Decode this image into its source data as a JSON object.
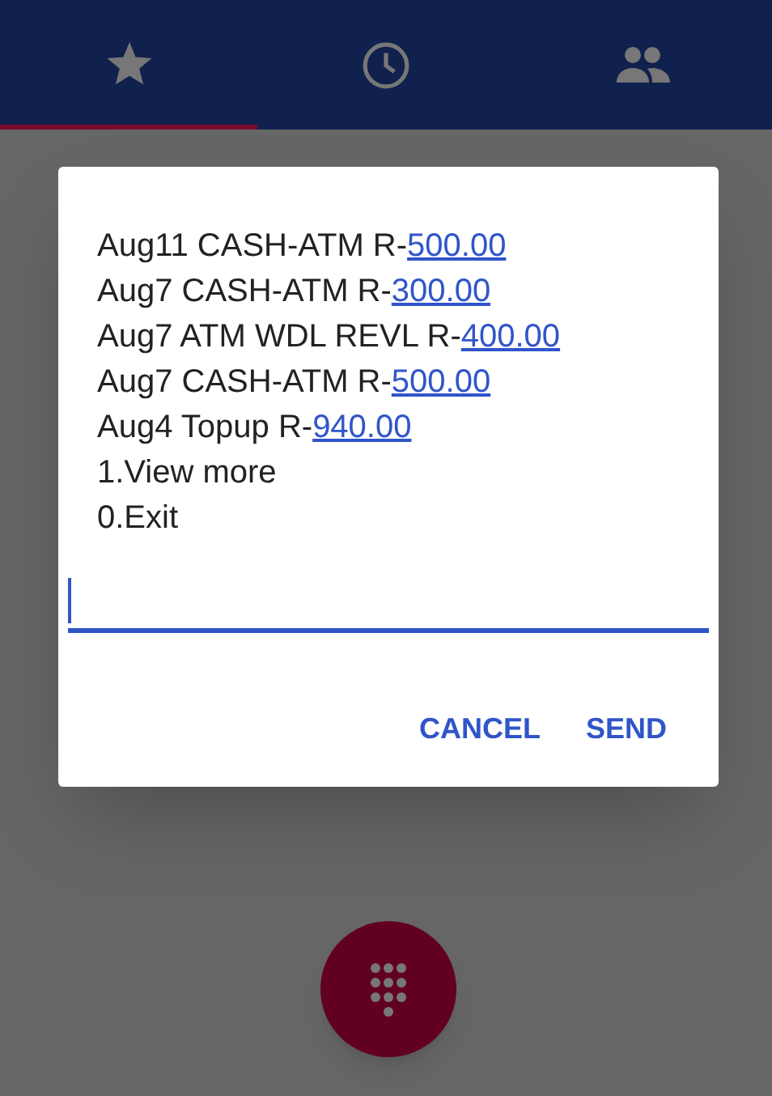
{
  "tabs": [
    {
      "kind": "star",
      "selected": true
    },
    {
      "kind": "clock",
      "selected": false
    },
    {
      "kind": "people",
      "selected": false
    }
  ],
  "dialog": {
    "lines": [
      {
        "text": "Aug11 CASH-ATM R-",
        "link": "500.00"
      },
      {
        "text": "Aug7 CASH-ATM R-",
        "link": "300.00"
      },
      {
        "text": "Aug7 ATM WDL REVL R-",
        "link": "400.00"
      },
      {
        "text": "Aug7 CASH-ATM R-",
        "link": "500.00"
      },
      {
        "text": "Aug4 Topup R-",
        "link": "940.00"
      },
      {
        "text": "1.View more"
      },
      {
        "text": "0.Exit"
      }
    ],
    "buttons": [
      "CANCEL",
      "SEND"
    ]
  }
}
